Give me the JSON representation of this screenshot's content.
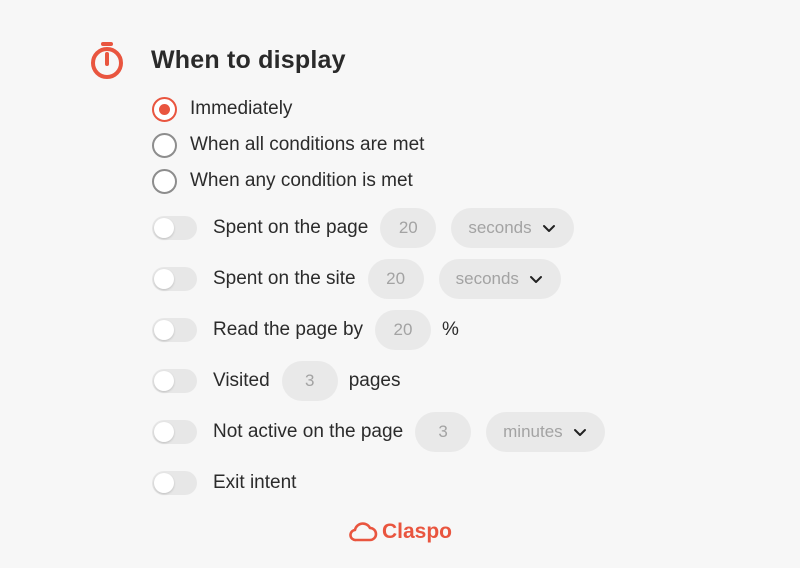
{
  "header": {
    "icon": "stopwatch-icon",
    "title": "When to display",
    "accent_color": "#e9553f"
  },
  "display_mode": {
    "options": [
      {
        "label": "Immediately",
        "checked": true
      },
      {
        "label": "When all conditions are met",
        "checked": false
      },
      {
        "label": "When any condition is met",
        "checked": false
      }
    ]
  },
  "conditions": {
    "spent_on_page": {
      "label": "Spent on the page",
      "value": "20",
      "unit": "seconds",
      "enabled": false
    },
    "spent_on_site": {
      "label": "Spent on the site",
      "value": "20",
      "unit": "seconds",
      "enabled": false
    },
    "read_page": {
      "label": "Read the page by",
      "value": "20",
      "suffix": "%",
      "enabled": false
    },
    "visited": {
      "label": "Visited",
      "value": "3",
      "suffix": "pages",
      "enabled": false
    },
    "not_active": {
      "label": "Not active on the page",
      "value": "3",
      "unit": "minutes",
      "enabled": false
    },
    "exit_intent": {
      "label": "Exit intent",
      "enabled": false
    }
  },
  "footer": {
    "brand": "Claspo",
    "logo_icon": "cloud-icon"
  }
}
